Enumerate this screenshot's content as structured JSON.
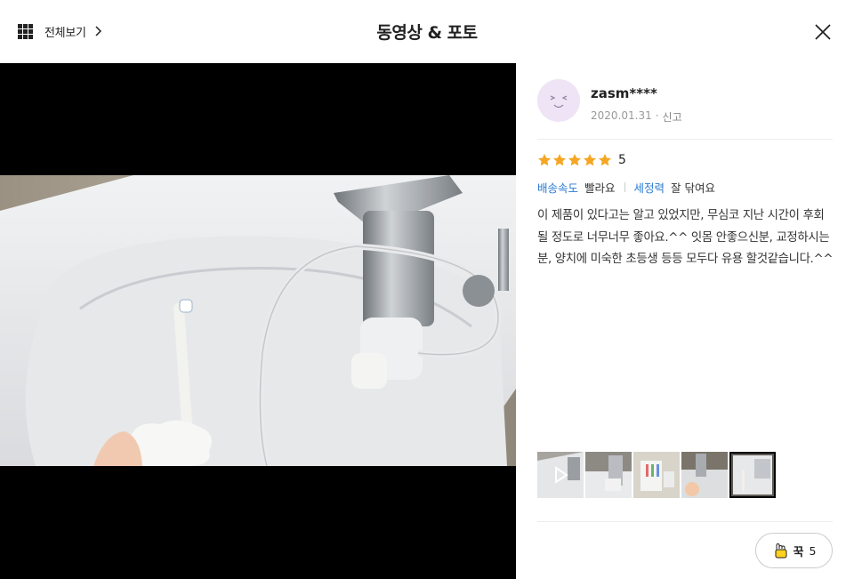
{
  "header": {
    "view_all_label": "전체보기",
    "title": "동영상 & 포토"
  },
  "review": {
    "user": "zasm****",
    "date": "2020.01.31",
    "meta_separator": "·",
    "report_label": "신고",
    "rating": 5,
    "rating_text": "5",
    "attributes": [
      {
        "key": "배송속도",
        "value": "빨라요"
      },
      {
        "key": "세정력",
        "value": "잘 닦여요"
      }
    ],
    "text": "이 제품이 있다고는 알고 있었지만, 무심코 지난 시간이 후회 될 정도로 너무너무 좋아요.^^ 잇몸 안좋으신분, 교정하시는분, 양치에 미숙한 초등생 등등 모두다 유용 할것같습니다.^^"
  },
  "thumbnails": [
    {
      "kind": "video",
      "icon": "play-icon"
    },
    {
      "kind": "photo"
    },
    {
      "kind": "photo"
    },
    {
      "kind": "photo"
    },
    {
      "kind": "photo",
      "selected": true
    }
  ],
  "like": {
    "label": "꾹",
    "count": "5"
  },
  "colors": {
    "accent_blue": "#2a7bd3",
    "star": "#f5a623",
    "avatar_bg": "#efe4f5"
  }
}
